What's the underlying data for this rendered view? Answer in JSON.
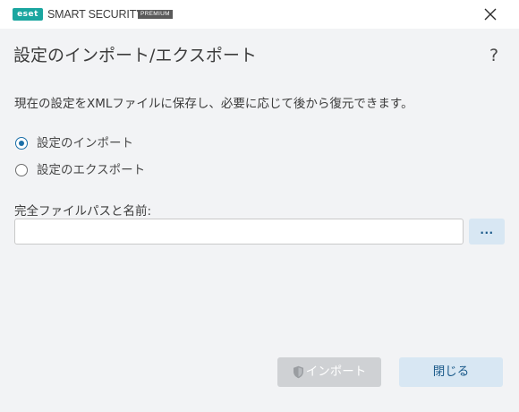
{
  "titlebar": {
    "logo_text": "eset",
    "product_name": "SMART SECURITY",
    "edition": "PREMIUM",
    "close_icon": "close-icon"
  },
  "dialog": {
    "title": "設定のインポート/エクスポート",
    "help_label": "?",
    "description": "現在の設定をXMLファイルに保存し、必要に応じて後から復元できます。"
  },
  "options": {
    "selected": "import",
    "items": [
      {
        "id": "import",
        "label": "設定のインポート",
        "checked": true
      },
      {
        "id": "export",
        "label": "設定のエクスポート",
        "checked": false
      }
    ]
  },
  "file": {
    "label": "完全ファイルパスと名前:",
    "value": "",
    "placeholder": "",
    "browse_label": "..."
  },
  "buttons": {
    "import_label": "インポート",
    "import_icon": "shield-icon",
    "import_enabled": false,
    "close_label": "閉じる"
  },
  "colors": {
    "brand": "#1aa6a0",
    "accent": "#1b6fa8",
    "button_secondary_bg": "#d8e7f3",
    "button_disabled_bg": "#cfd1d4",
    "dialog_bg": "#f2f3f5"
  }
}
